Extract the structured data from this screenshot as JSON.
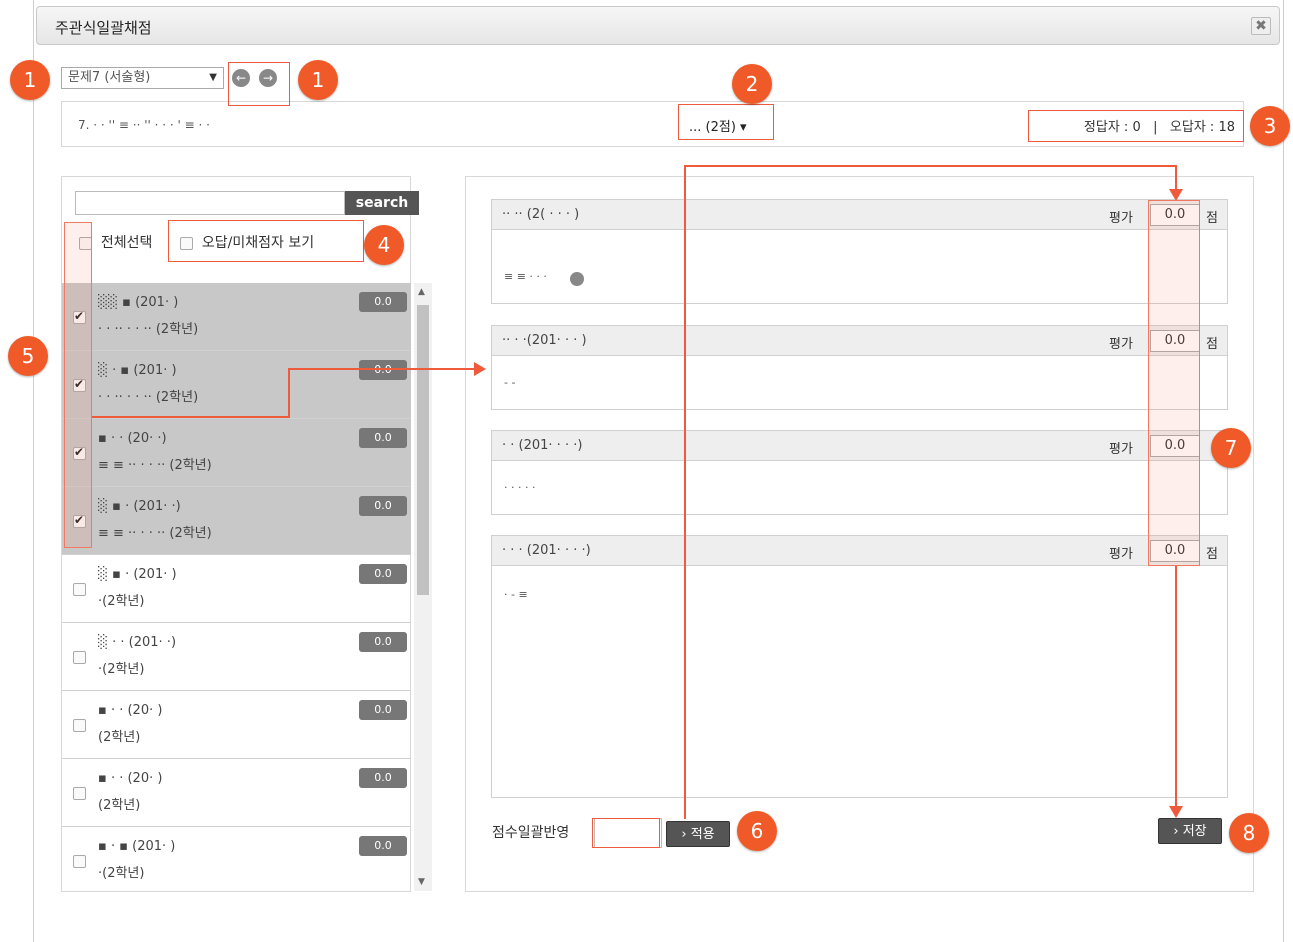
{
  "window": {
    "title": "주관식일괄채점",
    "close_icon": "✖"
  },
  "question_nav": {
    "selected_question": "문제7 (서술형)",
    "prev_icon": "←",
    "next_icon": "→"
  },
  "question": {
    "text": "7.  ·       ·  '' ≡  ·· ''                  ·                       ·          · '                ≡         ·          ·",
    "points": "... (2점)",
    "correct_label": "정답자 : 0",
    "separator": "|",
    "wrong_label": "오답자 : 18"
  },
  "left": {
    "search_placeholder": "",
    "search_button": "search",
    "select_all": "전체선택",
    "show_wrong": "오답/미채점자 보기",
    "students": [
      {
        "name": "░░ ▪ (201·        )",
        "grade": "·  ·   ·· ·  ·  ·· (2학년)",
        "score": "0.0",
        "checked": true
      },
      {
        "name": "░ · ▪ (201·        )",
        "grade": "·      ·  ·· ·  ·  ·· (2학년)",
        "score": "0.0",
        "checked": true
      },
      {
        "name": "▪ · · (20·          ·)",
        "grade": "≡      ≡ ·· ·  ·  ·· (2학년)",
        "score": "0.0",
        "checked": true
      },
      {
        "name": "░ ▪ · (201·          ·)",
        "grade": "≡      ≡ ·· ·  ·  ·· (2학년)",
        "score": "0.0",
        "checked": true
      },
      {
        "name": "░ ▪ · (201·        )",
        "grade": "·(2학년)",
        "score": "0.0",
        "checked": false
      },
      {
        "name": "░ · · (201·          ·)",
        "grade": "·(2학년)",
        "score": "0.0",
        "checked": false
      },
      {
        "name": "▪ · · (20·          )",
        "grade": "(2학년)",
        "score": "0.0",
        "checked": false
      },
      {
        "name": "▪ · · (20·          )",
        "grade": "(2학년)",
        "score": "0.0",
        "checked": false
      },
      {
        "name": "▪ · ▪ (201·          )",
        "grade": "·(2학년)",
        "score": "0.0",
        "checked": false
      }
    ]
  },
  "answers": [
    {
      "student": "·· ·· (2(  ·   ·  ·  )",
      "eval_label": "평가",
      "score": "0.0",
      "unit": "점",
      "body": "≡ ≡          ·                                     ·                          ·"
    },
    {
      "student": "·· · ·(201·  · · )",
      "eval_label": "평가",
      "score": "0.0",
      "unit": "점",
      "body": "                         -           -"
    },
    {
      "student": "·  · (201·  · · ·)",
      "eval_label": "평가",
      "score": "0.0",
      "unit": "",
      "body": "·  ·    · ·  ·"
    },
    {
      "student": "· · · (201·  · · ·)",
      "eval_label": "평가",
      "score": "0.0",
      "unit": "점",
      "body": "·                         -                                                      ≡"
    }
  ],
  "bulk": {
    "label": "점수일괄반영",
    "apply_button": "› 적용",
    "save_button": "› 저장"
  },
  "callouts": [
    "1",
    "1",
    "2",
    "3",
    "4",
    "5",
    "6",
    "7",
    "8"
  ],
  "colors": {
    "accent": "#f05a28",
    "dark_button": "#555555",
    "selected_row": "#c8c8c8"
  }
}
